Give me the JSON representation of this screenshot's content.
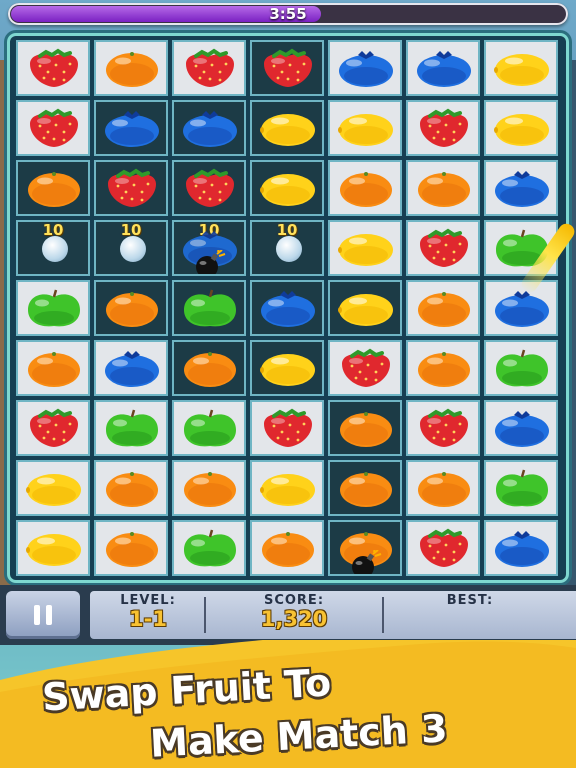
{
  "timer": {
    "text": "3:55",
    "fill_fraction": 0.56
  },
  "board": {
    "rows": [
      [
        "strawberry",
        "orange",
        "strawberry",
        "strawberry",
        "blueberry",
        "blueberry",
        "lemon"
      ],
      [
        "strawberry",
        "blueberry",
        "blueberry",
        "lemon",
        "lemon",
        "strawberry",
        "lemon"
      ],
      [
        "orange",
        "strawberry",
        "strawberry",
        "lemon",
        "orange",
        "orange",
        "blueberry"
      ],
      [
        "bonus",
        "bonus",
        "bonus-bomb",
        "bonus",
        "lemon",
        "strawberry",
        "apple"
      ],
      [
        "apple",
        "orange",
        "apple",
        "blueberry",
        "lemon",
        "orange",
        "blueberry"
      ],
      [
        "orange",
        "blueberry",
        "orange",
        "lemon",
        "strawberry",
        "orange",
        "apple"
      ],
      [
        "strawberry",
        "apple",
        "apple",
        "strawberry",
        "orange",
        "strawberry",
        "blueberry"
      ],
      [
        "lemon",
        "orange",
        "orange",
        "lemon",
        "orange",
        "orange",
        "apple"
      ],
      [
        "lemon",
        "orange",
        "apple",
        "orange",
        "orange-bomb",
        "strawberry",
        "blueberry"
      ]
    ],
    "cell_shades": [
      [
        "light",
        "light",
        "light",
        "dark",
        "light",
        "light",
        "light"
      ],
      [
        "light",
        "dark",
        "dark",
        "dark",
        "light",
        "light",
        "light"
      ],
      [
        "dark",
        "dark",
        "dark",
        "dark",
        "light",
        "light",
        "light"
      ],
      [
        "dark",
        "dark",
        "dark",
        "dark",
        "light",
        "light",
        "light"
      ],
      [
        "light",
        "dark",
        "dark",
        "dark",
        "dark",
        "light",
        "light"
      ],
      [
        "light",
        "light",
        "dark",
        "dark",
        "light",
        "light",
        "light"
      ],
      [
        "light",
        "light",
        "light",
        "light",
        "dark",
        "light",
        "light"
      ],
      [
        "light",
        "light",
        "light",
        "light",
        "dark",
        "light",
        "light"
      ],
      [
        "light",
        "light",
        "light",
        "light",
        "dark",
        "light",
        "light"
      ]
    ],
    "bonus_value": "10"
  },
  "hud": {
    "level_label": "LEVEL:",
    "level_value": "1-1",
    "score_label": "SCORE:",
    "score_value": "1,320",
    "best_label": "BEST:"
  },
  "banner": {
    "line1": "Swap Fruit To",
    "line2": "Make Match 3"
  },
  "colors": {
    "strawberry": "#e0282e",
    "orange": "#f98c12",
    "lemon": "#ffd21a",
    "blueberry": "#1f6fe0",
    "apple": "#3fc42a",
    "timer_fill": "#9b40d8",
    "banner_yellow": "#f6c52a"
  }
}
